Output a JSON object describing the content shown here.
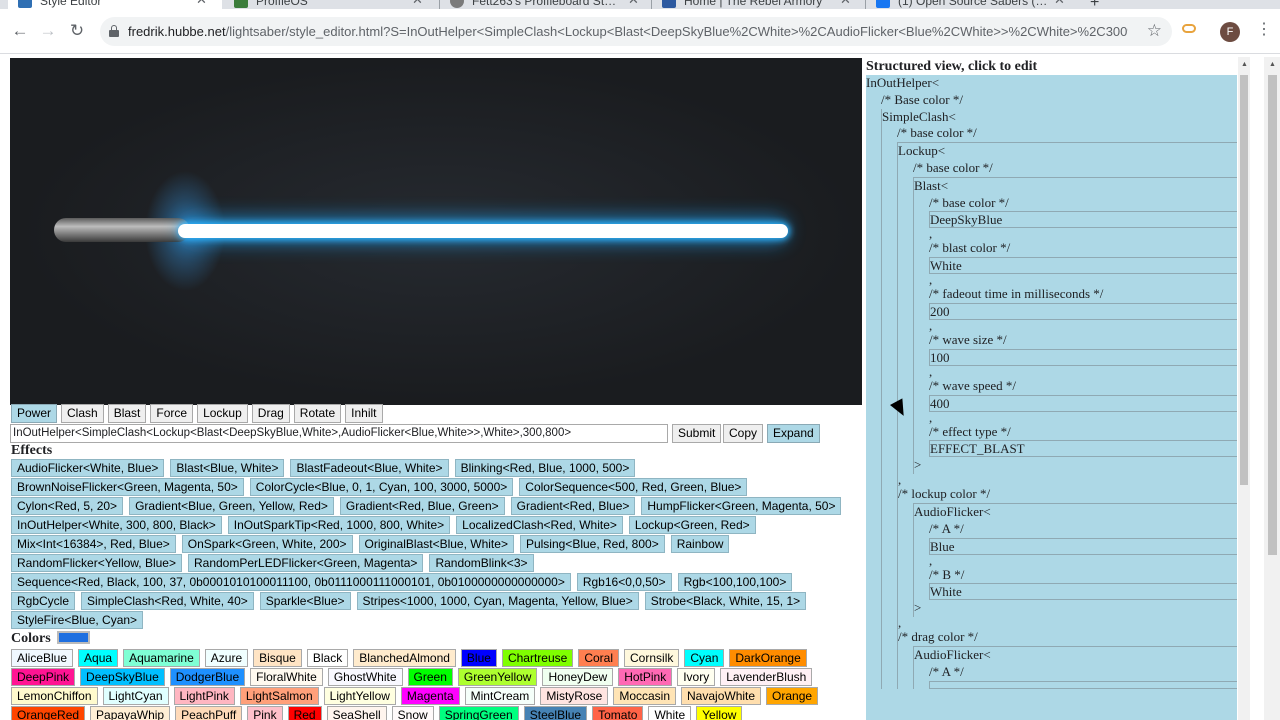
{
  "browser": {
    "tabs": [
      {
        "title": "Style Editor",
        "favicon_color": "#2f6fb3",
        "active": true
      },
      {
        "title": "ProffieOS",
        "favicon_color": "#3b7d3b",
        "active": false
      },
      {
        "title": "Fett263's Proffieboard Style Libr",
        "favicon_color": "#7a7a7a",
        "active": false
      },
      {
        "title": "Home | The Rebel Armory",
        "favicon_color": "#2d5aa0",
        "active": false
      },
      {
        "title": "(1) Open Source Sabers (Teensy/",
        "favicon_color": "#1877f2",
        "active": false
      }
    ],
    "new_tab": "+",
    "url_host": "fredrik.hubbe.net",
    "url_path": "/lightsaber/style_editor.html?S=InOutHelper<SimpleClash<Lockup<Blast<DeepSkyBlue%2CWhite>%2CAudioFlicker<Blue%2CWhite>>%2CWhite>%2C300%2C80...",
    "profile_initial": "F"
  },
  "buttons": {
    "actions": [
      "Power",
      "Clash",
      "Blast",
      "Force",
      "Lockup",
      "Drag",
      "Rotate",
      "Inhilt"
    ],
    "style_text": "InOutHelper<SimpleClash<Lockup<Blast<DeepSkyBlue,White>,AudioFlicker<Blue,White>>,White>,300,800>",
    "submit": "Submit",
    "copy": "Copy",
    "expand": "Expand"
  },
  "effects_title": "Effects",
  "effects": [
    "AudioFlicker<White, Blue>",
    "Blast<Blue, White>",
    "BlastFadeout<Blue, White>",
    "Blinking<Red, Blue, 1000, 500>",
    "BrownNoiseFlicker<Green, Magenta, 50>",
    "ColorCycle<Blue,  0, 1, Cyan,  100, 3000, 5000>",
    "ColorSequence<500, Red, Green, Blue>",
    "Cylon<Red, 5, 20>",
    "Gradient<Blue, Green, Yellow, Red>",
    "Gradient<Red, Blue, Green>",
    "Gradient<Red, Blue>",
    "HumpFlicker<Green, Magenta, 50>",
    "InOutHelper<White, 300, 800, Black>",
    "InOutSparkTip<Red, 1000, 800, White>",
    "LocalizedClash<Red, White>",
    "Lockup<Green, Red>",
    "Mix<Int<16384>, Red, Blue>",
    "OnSpark<Green, White, 200>",
    "OriginalBlast<Blue, White>",
    "Pulsing<Blue, Red, 800>",
    "Rainbow",
    "RandomFlicker<Yellow, Blue>",
    "RandomPerLEDFlicker<Green, Magenta>",
    "RandomBlink<3>",
    "Sequence<Red, Black, 100, 37, 0b0001010100011100, 0b0111000111000101, 0b0100000000000000>",
    "Rgb16<0,0,50>",
    "Rgb<100,100,100>",
    "RgbCycle",
    "SimpleClash<Red, White, 40>",
    "Sparkle<Blue>",
    "Stripes<1000, 1000, Cyan, Magenta, Yellow, Blue>",
    "Strobe<Black, White, 15, 1>",
    "StyleFire<Blue, Cyan>"
  ],
  "colors_title": "Colors",
  "colors_title_swatch": "#1e6fe0",
  "colors": [
    {
      "name": "AliceBlue",
      "bg": "#f0f8ff"
    },
    {
      "name": "Aqua",
      "bg": "#00ffff"
    },
    {
      "name": "Aquamarine",
      "bg": "#7fffd4"
    },
    {
      "name": "Azure",
      "bg": "#f0ffff"
    },
    {
      "name": "Bisque",
      "bg": "#ffe4c4"
    },
    {
      "name": "Black",
      "bg": "#ffffff"
    },
    {
      "name": "BlanchedAlmond",
      "bg": "#ffebcd"
    },
    {
      "name": "Blue",
      "bg": "#0000ff"
    },
    {
      "name": "Chartreuse",
      "bg": "#7fff00"
    },
    {
      "name": "Coral",
      "bg": "#ff7f50"
    },
    {
      "name": "Cornsilk",
      "bg": "#fff8dc"
    },
    {
      "name": "Cyan",
      "bg": "#00ffff"
    },
    {
      "name": "DarkOrange",
      "bg": "#ff8c00"
    },
    {
      "name": "DeepPink",
      "bg": "#ff1493"
    },
    {
      "name": "DeepSkyBlue",
      "bg": "#00bfff"
    },
    {
      "name": "DodgerBlue",
      "bg": "#1e90ff"
    },
    {
      "name": "FloralWhite",
      "bg": "#fffaf0"
    },
    {
      "name": "GhostWhite",
      "bg": "#f8f8ff"
    },
    {
      "name": "Green",
      "bg": "#00ff00"
    },
    {
      "name": "GreenYellow",
      "bg": "#adff2f"
    },
    {
      "name": "HoneyDew",
      "bg": "#f0fff0"
    },
    {
      "name": "HotPink",
      "bg": "#ff69b4"
    },
    {
      "name": "Ivory",
      "bg": "#fffff0"
    },
    {
      "name": "LavenderBlush",
      "bg": "#fff0f5"
    },
    {
      "name": "LemonChiffon",
      "bg": "#fffacd"
    },
    {
      "name": "LightCyan",
      "bg": "#e0ffff"
    },
    {
      "name": "LightPink",
      "bg": "#ffb6c1"
    },
    {
      "name": "LightSalmon",
      "bg": "#ffa07a"
    },
    {
      "name": "LightYellow",
      "bg": "#ffffe0"
    },
    {
      "name": "Magenta",
      "bg": "#ff00ff"
    },
    {
      "name": "MintCream",
      "bg": "#f5fffa"
    },
    {
      "name": "MistyRose",
      "bg": "#ffe4e1"
    },
    {
      "name": "Moccasin",
      "bg": "#ffe4b5"
    },
    {
      "name": "NavajoWhite",
      "bg": "#ffdead"
    },
    {
      "name": "Orange",
      "bg": "#ffa500"
    },
    {
      "name": "OrangeRed",
      "bg": "#ff4500"
    },
    {
      "name": "PapayaWhip",
      "bg": "#ffefd5"
    },
    {
      "name": "PeachPuff",
      "bg": "#ffdab9"
    },
    {
      "name": "Pink",
      "bg": "#ffc0cb"
    },
    {
      "name": "Red",
      "bg": "#ff0000"
    },
    {
      "name": "SeaShell",
      "bg": "#fff5ee"
    },
    {
      "name": "Snow",
      "bg": "#fffafa"
    },
    {
      "name": "SpringGreen",
      "bg": "#00ff7f"
    },
    {
      "name": "SteelBlue",
      "bg": "#4682b4"
    },
    {
      "name": "Tomato",
      "bg": "#ff6347"
    },
    {
      "name": "White",
      "bg": "#ffffff"
    },
    {
      "name": "Yellow",
      "bg": "#ffff00"
    }
  ],
  "structured": {
    "title": "Structured view, click to edit",
    "root": "InOutHelper<",
    "base_color_comment": "/* Base color */",
    "simple_clash": "SimpleClash<",
    "base_color_comment2": "/* base color */",
    "lockup": "Lockup<",
    "base_color_comment3": "/* base color */",
    "blast": "Blast<",
    "blast_base_comment": "/* base color */",
    "blast_base_value": "DeepSkyBlue",
    "comma": ",",
    "blast_color_comment": "/* blast color */",
    "blast_color_value": "White",
    "fadeout_comment": "/* fadeout time in milliseconds */",
    "fadeout_value": "200",
    "wave_size_comment": "/* wave size */",
    "wave_size_value": "100",
    "wave_speed_comment": "/* wave speed */",
    "wave_speed_value": "400",
    "effect_type_comment": "/* effect type */",
    "effect_type_value": "EFFECT_BLAST",
    "close": ">",
    "lockup_color_comment": "/* lockup color */",
    "audioflicker": "AudioFlicker<",
    "a_comment": "/* A */",
    "a_value": "Blue",
    "b_comment": "/* B */",
    "b_value": "White",
    "drag_color_comment": "/* drag color */",
    "audioflicker2": "AudioFlicker<",
    "a_comment2": "/* A */"
  },
  "saber": {
    "blade_color": "#ffffff",
    "glow_color": "#1fa8ff",
    "hilt_color": "#8a8a8a"
  }
}
